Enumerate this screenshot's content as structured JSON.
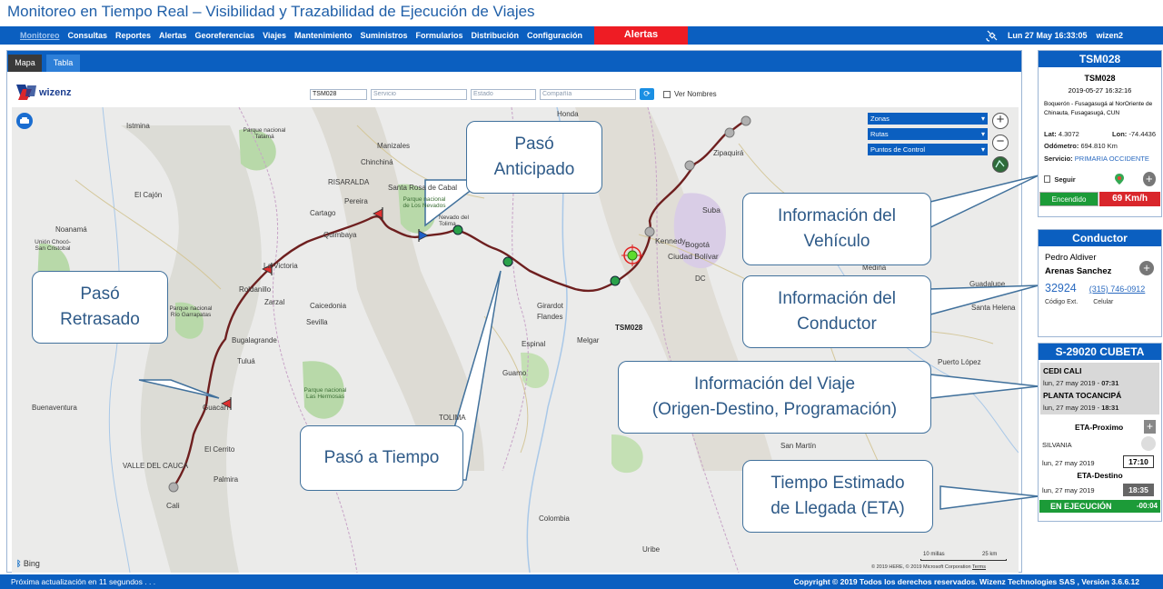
{
  "page": {
    "title": "Monitoreo en Tiempo Real – Visibilidad y Trazabilidad de Ejecución de Viajes"
  },
  "nav": {
    "items": [
      "Monitoreo",
      "Consultas",
      "Reportes",
      "Alertas",
      "Georeferencias",
      "Viajes",
      "Mantenimiento",
      "Suministros",
      "Formularios",
      "Distribución",
      "Configuración"
    ],
    "alert_button": "Alertas",
    "datetime": "Lun 27 May 16:33:05",
    "user": "wizen2"
  },
  "tabs": {
    "mapa": "Mapa",
    "tabla": "Tabla"
  },
  "search": {
    "vehicle_value": "TSM028",
    "servicio_placeholder": "Servicio",
    "estado_placeholder": "Estado",
    "compania_placeholder": "Compañía",
    "ver_nombres": "Ver Nombres",
    "logo_text": "wizenz"
  },
  "layers": {
    "zonas": "Zonas",
    "rutas": "Rutas",
    "puntos": "Puntos de Control"
  },
  "map_labels": {
    "honda": "Honda",
    "istmina": "Istmina",
    "manizales": "Manizales",
    "chinchina": "Chinchiná",
    "risaralda": "RISARALDA",
    "santa_rosa": "Santa Rosa de Cabal",
    "pereira": "Pereira",
    "parque_tatama": "Parque nacional Tatamá",
    "parque_nevados": "Parque nacional de Los Nevados",
    "nevado_tolima": "Nevado del Tolima",
    "el_cajon": "El Cajón",
    "noanama": "Noanamá",
    "cartago": "Cartago",
    "quimbaya": "Quimbaya",
    "la_victoria": "La Victoria",
    "union_chocoano": "Unión Chocó-San Cristobal",
    "rio_garrapatas": "Parque nacional Río Garrapatas",
    "roldanillo": "Roldanillo",
    "zarzal": "Zarzal",
    "caicedonia": "Caicedonia",
    "sevilla": "Sevilla",
    "bugalagrande": "Bugalagrande",
    "tulua": "Tuluá",
    "buenaventura": "Buenaventura",
    "guacari": "Guacarí",
    "el_cerrito": "El Cerrito",
    "valle": "VALLE DEL CAUCA",
    "palmira": "Palmira",
    "cali": "Cali",
    "parque_hermosas": "Parque nacional Las Hermosas",
    "tolima": "TOLIMA",
    "girardot": "Girardot",
    "flandes": "Flandes",
    "espinal": "Espinal",
    "melgar": "Melgar",
    "guamo": "Guamo",
    "zipaquira": "Zipaquirá",
    "suba": "Suba",
    "kennedy": "Kennedy",
    "bogota": "Bogotá",
    "ciudad_bolivar": "Ciudad Bolívar",
    "dc": "DC",
    "medina": "Medina",
    "guadalupe": "Guadalupe",
    "santa_helena": "Santa Helena",
    "puerto_lopez": "Puerto López",
    "san_martin": "San Martín",
    "colombia": "Colombia",
    "uribe": "Uribe",
    "tsm028": "TSM028"
  },
  "map_footer": {
    "bing": "Bing",
    "scale_miles": "10 millas",
    "scale_km": "25 km",
    "copyright": "© 2019 HERE, © 2019 Microsoft Corporation",
    "terms": "Terms"
  },
  "callouts": {
    "anticipado": "Pasó Anticipado",
    "retrasado": "Pasó Retrasado",
    "tiempo": "Pasó a Tiempo",
    "vehiculo": "Información del Vehículo",
    "conductor": "Información del Conductor",
    "viaje_l1": "Información del Viaje",
    "viaje_l2": "(Origen-Destino, Programación)",
    "eta_l1": "Tiempo Estimado",
    "eta_l2": "de Llegada (ETA)"
  },
  "vehicle": {
    "header": "TSM028",
    "id": "TSM028",
    "timestamp": "2019-05-27 16:32:16",
    "address": "Boquerón - Fusagasugá al NorOriente de Chinauta, Fusagasugá, CUN",
    "lat_label": "Lat:",
    "lat": "4.3072",
    "lon_label": "Lon:",
    "lon": "-74.4436",
    "odometro_label": "Odómetro:",
    "odometro": "694.810 Km",
    "servicio_label": "Servicio:",
    "servicio": "PRIMARIA OCCIDENTE",
    "seguir": "Seguir",
    "status": "Encendido",
    "speed": "69 Km/h"
  },
  "driver": {
    "header": "Conductor",
    "first": "Pedro Aldiver",
    "last": "Arenas Sanchez",
    "code": "32924",
    "phone": "(315) 746-0912",
    "code_label": "Código Ext.",
    "phone_label": "Celular"
  },
  "trip": {
    "header": "S-29020 CUBETA",
    "origin": "CEDI CALI",
    "origin_date": "lun, 27 may 2019 -",
    "origin_time": "07:31",
    "dest": "PLANTA TOCANCIPÁ",
    "dest_date": "lun, 27 may 2019 -",
    "dest_time": "18:31",
    "eta_prox_label": "ETA-Proximo",
    "next_point": "SILVANIA",
    "next_date": "lun, 27 may 2019",
    "next_time": "17:10",
    "eta_dest_label": "ETA-Destino",
    "dest_eta_date": "lun, 27 may 2019",
    "dest_eta_time": "18:35",
    "status": "EN EJECUCIÓN",
    "delay": "-00:04"
  },
  "footer": {
    "left": "Próxima actualización en 11 segundos . . .",
    "right": "Copyright © 2019 Todos los derechos reservados. Wizenz Technologies SAS , Versión 3.6.6.12"
  }
}
